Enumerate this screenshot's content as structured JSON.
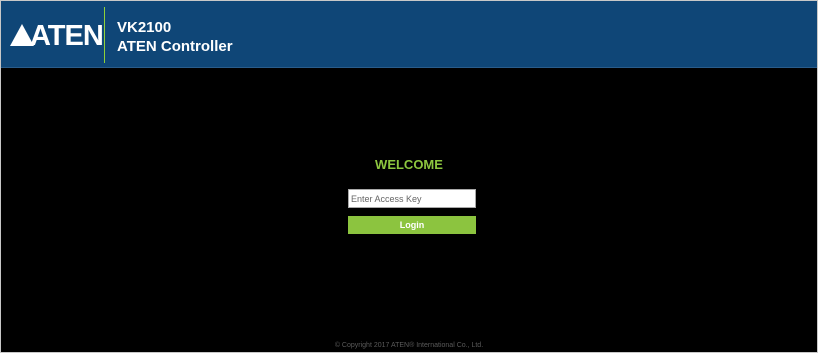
{
  "header": {
    "logo_text": "ATEN",
    "product": "VK2100",
    "app_name": "ATEN Controller"
  },
  "login": {
    "welcome": "WELCOME",
    "access_key_placeholder": "Enter Access Key",
    "access_key_value": "",
    "login_label": "Login"
  },
  "footer": {
    "copyright": "© Copyright 2017 ATEN® International Co., Ltd."
  },
  "colors": {
    "header_bg": "#0f4677",
    "accent_green": "#8cc43f",
    "page_bg": "#000000"
  }
}
